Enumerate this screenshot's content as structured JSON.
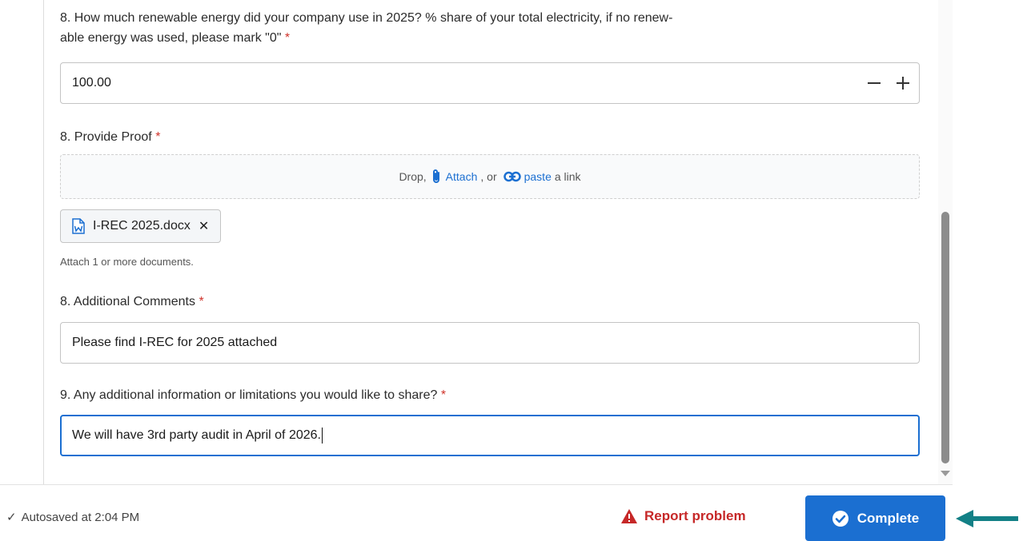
{
  "questions": {
    "q8_renewable": {
      "label": "8. How much renewable energy did your company use in 2025? % share of your total electricity, if no renew-",
      "label_line2": "able energy was used, please mark \"0\"",
      "required_mark": "*",
      "value": "100.00",
      "decrement_symbol": "−",
      "increment_symbol": "+"
    },
    "q8_proof": {
      "label": "8. Provide Proof",
      "required_mark": "*",
      "dropzone": {
        "drop_text": "Drop,",
        "attach_text": "Attach",
        "or_text": ", or",
        "paste_text": "paste",
        "link_text": "a link"
      },
      "attachment": {
        "filename": "I-REC 2025.docx",
        "icon": "word-doc-icon",
        "remove_symbol": "✕"
      },
      "hint": "Attach 1 or more documents."
    },
    "q8_comments": {
      "label": "8. Additional Comments",
      "required_mark": "*",
      "value": "Please find I-REC for 2025 attached"
    },
    "q9_additional": {
      "label": "9. Any additional information or limitations you would like to share?",
      "required_mark": "*",
      "value": "We will have 3rd party audit in April of 2026."
    }
  },
  "footer": {
    "autosave_check": "✓",
    "autosave_text": "Autosaved at 2:04 PM",
    "report_label": "Report problem",
    "complete_label": "Complete"
  },
  "colors": {
    "accent": "#1b6fd1",
    "required": "#d0342c",
    "report": "#c62828",
    "annotation_arrow": "#138086"
  }
}
